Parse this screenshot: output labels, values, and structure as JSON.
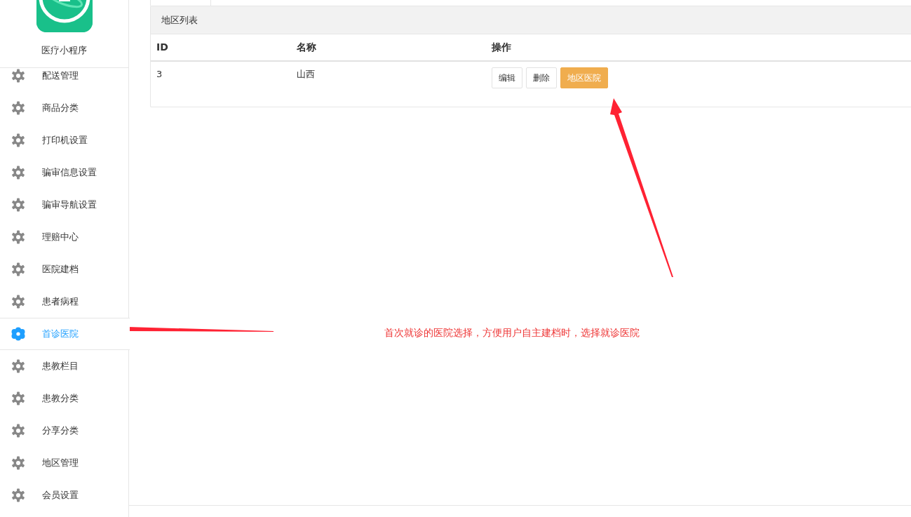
{
  "sidebar": {
    "app_name": "医疗小程序",
    "items": [
      {
        "label": "配送管理",
        "selected": false
      },
      {
        "label": "商品分类",
        "selected": false
      },
      {
        "label": "打印机设置",
        "selected": false
      },
      {
        "label": "骗审信息设置",
        "selected": false
      },
      {
        "label": "骗审导航设置",
        "selected": false
      },
      {
        "label": "理赔中心",
        "selected": false
      },
      {
        "label": "医院建档",
        "selected": false
      },
      {
        "label": "患者病程",
        "selected": false
      },
      {
        "label": "首诊医院",
        "selected": true
      },
      {
        "label": "患教栏目",
        "selected": false
      },
      {
        "label": "患教分类",
        "selected": false
      },
      {
        "label": "分享分类",
        "selected": false
      },
      {
        "label": "地区管理",
        "selected": false
      },
      {
        "label": "会员设置",
        "selected": false
      }
    ]
  },
  "panel": {
    "title": "地区列表",
    "table": {
      "columns": [
        "ID",
        "名称",
        "操作"
      ],
      "rows": [
        {
          "cells": [
            "3",
            "山西"
          ],
          "actions": [
            {
              "label": "编辑",
              "kind": "default"
            },
            {
              "label": "删除",
              "kind": "default"
            },
            {
              "label": "地区医院",
              "kind": "warning"
            }
          ]
        }
      ]
    }
  },
  "annotation": {
    "text": "首次就诊的医院选择，方便用户自主建档时，选择就诊医院"
  }
}
